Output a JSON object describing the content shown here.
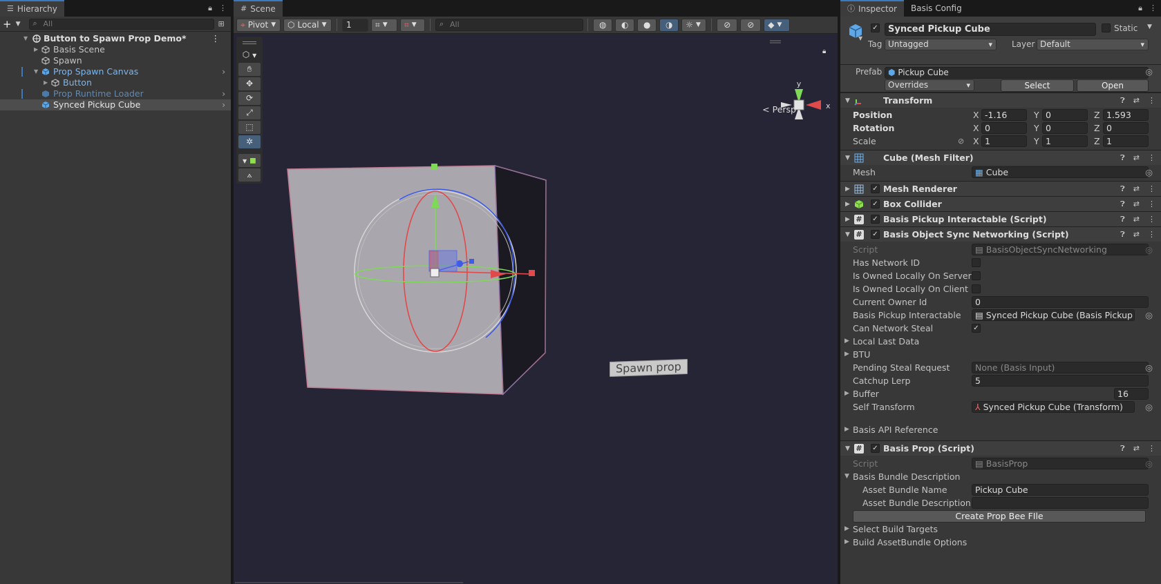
{
  "hierarchy": {
    "tab_label": "Hierarchy",
    "search_placeholder": "All",
    "scene_root": "Button to Spawn Prop Demo*",
    "items": [
      {
        "label": "Basis Scene"
      },
      {
        "label": "Spawn"
      },
      {
        "label": "Prop Spawn Canvas"
      },
      {
        "label": "Button"
      },
      {
        "label": "Prop Runtime Loader"
      },
      {
        "label": "Synced Pickup Cube"
      }
    ]
  },
  "scene": {
    "tab_label": "Scene",
    "pivot_label": "Pivot",
    "local_label": "Local",
    "grid_value": "1",
    "search_placeholder": "All",
    "persp_label": "Persp",
    "gizmo_y": "y",
    "gizmo_x": "x",
    "spawn_button_text": "Spawn prop"
  },
  "inspector": {
    "tab_label": "Inspector",
    "tab2_label": "Basis Config",
    "object_name": "Synced Pickup Cube",
    "static_label": "Static",
    "tag_label": "Tag",
    "tag_value": "Untagged",
    "layer_label": "Layer",
    "layer_value": "Default",
    "prefab_label": "Prefab",
    "prefab_value": "Pickup Cube",
    "overrides_label": "Overrides",
    "select_label": "Select",
    "open_label": "Open",
    "transform": {
      "title": "Transform",
      "position_label": "Position",
      "rotation_label": "Rotation",
      "scale_label": "Scale",
      "pos": {
        "x": "-1.16",
        "y": "0",
        "z": "1.593"
      },
      "rot": {
        "x": "0",
        "y": "0",
        "z": "0"
      },
      "scale": {
        "x": "1",
        "y": "1",
        "z": "1"
      }
    },
    "axis": {
      "x": "X",
      "y": "Y",
      "z": "Z"
    },
    "mesh_filter": {
      "title": "Cube (Mesh Filter)",
      "mesh_label": "Mesh",
      "mesh_value": "Cube"
    },
    "mesh_renderer": "Mesh Renderer",
    "box_collider": "Box Collider",
    "pickup_interactable": "Basis Pickup Interactable (Script)",
    "sync": {
      "title": "Basis Object Sync Networking (Script)",
      "script_label": "Script",
      "script_value": "BasisObjectSyncNetworking",
      "has_network_id": "Has Network ID",
      "owned_server": "Is Owned Locally On Server",
      "owned_client": "Is Owned Locally On Client",
      "current_owner_label": "Current Owner Id",
      "current_owner_value": "0",
      "pickup_label": "Basis Pickup Interactable",
      "pickup_value": "Synced Pickup Cube (Basis Pickup Inte",
      "can_steal": "Can Network Steal",
      "local_last_data": "Local Last Data",
      "btu": "BTU",
      "pending_label": "Pending Steal Request",
      "pending_value": "None (Basis Input)",
      "catchup_label": "Catchup Lerp",
      "catchup_value": "5",
      "buffer_label": "Buffer",
      "buffer_value": "16",
      "self_transform_label": "Self Transform",
      "self_transform_value": "Synced Pickup Cube (Transform)",
      "api_ref": "Basis API Reference"
    },
    "prop": {
      "title": "Basis Prop (Script)",
      "script_label": "Script",
      "script_value": "BasisProp",
      "bundle_desc": "Basis Bundle Description",
      "bundle_name_label": "Asset Bundle Name",
      "bundle_name_value": "Pickup Cube",
      "bundle_desc_label": "Asset Bundle Description",
      "bundle_desc_value": "",
      "create_btn": "Create Prop Bee FIle",
      "build_targets": "Select Build Targets",
      "build_options": "Build AssetBundle Options"
    }
  }
}
